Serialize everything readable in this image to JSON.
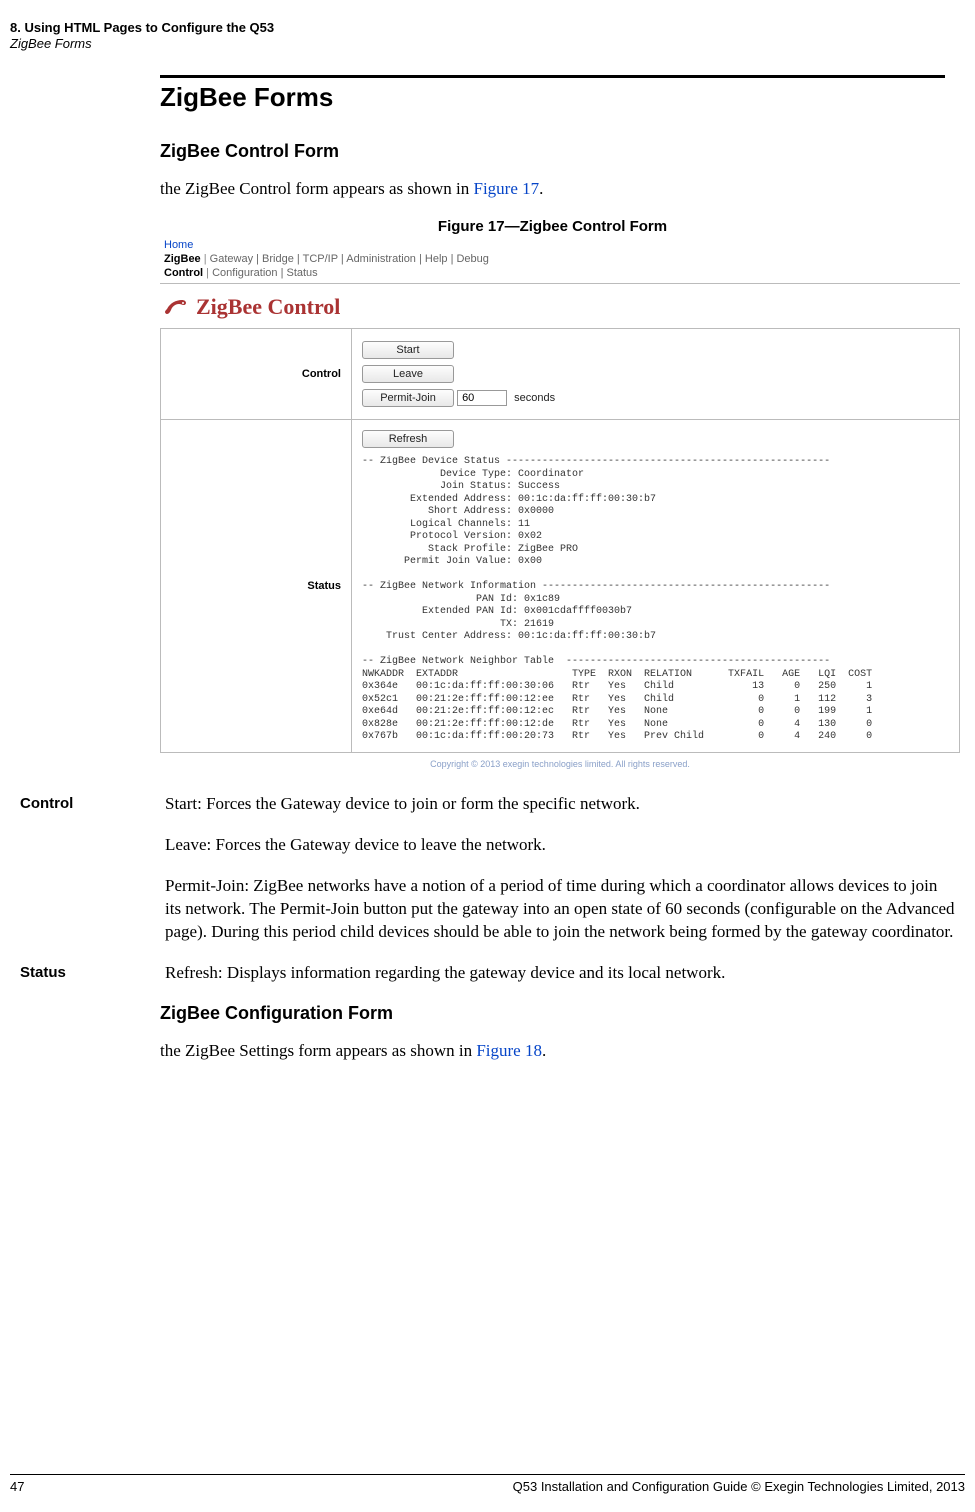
{
  "runhead": {
    "line1": "8. Using HTML Pages to Configure the Q53",
    "line2": "ZigBee Forms"
  },
  "section": {
    "title": "ZigBee Forms",
    "sub1_title": "ZigBee Control Form",
    "sub1_intro_pre": "the ZigBee Control form appears as shown in ",
    "sub1_intro_link": "Figure 17",
    "sub1_intro_post": ".",
    "fig17_caption": "Figure 17—Zigbee Control Form",
    "sub2_title": "ZigBee Configuration Form",
    "sub2_intro_pre": "the ZigBee Settings form appears as shown in ",
    "sub2_intro_link": "Figure 18",
    "sub2_intro_post": "."
  },
  "screenshot": {
    "crumb_home": "Home",
    "crumb_l1_active": "ZigBee",
    "crumb_l1_rest": "Gateway | Bridge | TCP/IP | Administration | Help | Debug",
    "crumb_l2_active": "Control",
    "crumb_l2_rest": "Configuration | Status",
    "panel_title": "ZigBee Control",
    "row_control_label": "Control",
    "btn_start": "Start",
    "btn_leave": "Leave",
    "btn_permit": "Permit-Join",
    "permit_value": "60",
    "permit_unit": "seconds",
    "row_status_label": "Status",
    "btn_refresh": "Refresh",
    "status_text": "-- ZigBee Device Status ------------------------------------------------------\n             Device Type: Coordinator\n             Join Status: Success\n        Extended Address: 00:1c:da:ff:ff:00:30:b7\n           Short Address: 0x0000\n        Logical Channels: 11\n        Protocol Version: 0x02\n           Stack Profile: ZigBee PRO\n       Permit Join Value: 0x00\n\n-- ZigBee Network Information ------------------------------------------------\n                   PAN Id: 0x1c89\n          Extended PAN Id: 0x001cdaffff0030b7\n                       TX: 21619\n    Trust Center Address: 00:1c:da:ff:ff:00:30:b7\n\n-- ZigBee Network Neighbor Table  --------------------------------------------\nNWKADDR  EXTADDR                   TYPE  RXON  RELATION      TXFAIL   AGE   LQI  COST\n0x364e   00:1c:da:ff:ff:00:30:06   Rtr   Yes   Child             13     0   250     1\n0x52c1   00:21:2e:ff:ff:00:12:ee   Rtr   Yes   Child              0     1   112     3\n0xe64d   00:21:2e:ff:ff:00:12:ec   Rtr   Yes   None               0     0   199     1\n0x828e   00:21:2e:ff:ff:00:12:de   Rtr   Yes   None               0     4   130     0\n0x767b   00:1c:da:ff:ff:00:20:73   Rtr   Yes   Prev Child         0     4   240     0",
    "copyright": "Copyright © 2013 exegin technologies limited. All rights reserved."
  },
  "defs": {
    "control_term": "Control",
    "control_p1": "Start: Forces the Gateway device to join or form the specific network.",
    "control_p2": "Leave: Forces the Gateway device to leave the network.",
    "control_p3": "Permit-Join: ZigBee networks have a notion of a period of time during which a coordinator allows devices to join its network. The Permit-Join button put the gateway into an open state of 60 seconds (configurable on the Advanced page). During this period child devices should be able to join the network being formed by the gateway coordinator.",
    "status_term": "Status",
    "status_p1": "Refresh: Displays information regarding the gateway device and its local network."
  },
  "footer": {
    "page": "47",
    "text": "Q53 Installation and Configuration Guide  © Exegin Technologies Limited, 2013"
  }
}
